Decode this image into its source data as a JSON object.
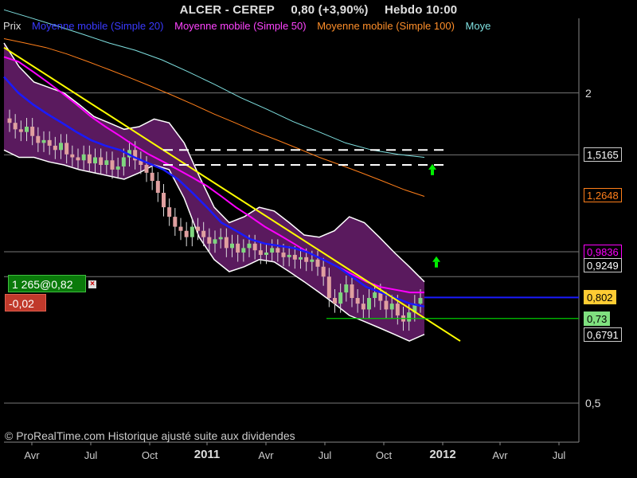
{
  "header": {
    "instrument": "ALCER - CEREP",
    "price_change": "0,80 (+3,90%)",
    "period_time": "Hebdo  10:00"
  },
  "legend": {
    "prix": "Prix",
    "ma20": "Moyenne mobile (Simple 20)",
    "ma50": "Moyenne mobile (Simple 50)",
    "ma100": "Moyenne mobile (Simple 100)",
    "ma_extra": "Moye"
  },
  "order": {
    "label": "1 265@0,82",
    "pnl": "-0,02"
  },
  "copyright": "© ProRealTime.com Historique ajusté suite aux dividendes",
  "colors": {
    "background": "#000000",
    "bollinger_fill": "#5a1a5e",
    "ma20": "#1a1aff",
    "ma50": "#ff00ff",
    "ma100": "#ff7f1a",
    "ma200": "#7fe0e0",
    "trendline": "#ffff00",
    "support_line": "#00cc00",
    "up_candle": "#7fd67f",
    "down_candle": "#e0a0a0"
  },
  "chart_data": {
    "type": "line",
    "y_scale": "log",
    "ylim": [
      0.42,
      2.6
    ],
    "y_ticks": [
      {
        "label": "2",
        "value": 2.0
      },
      {
        "label": "0,5",
        "value": 0.5
      }
    ],
    "x_ticks": [
      "Avr",
      "Jul",
      "Oct",
      "2011",
      "Avr",
      "Jul",
      "Oct",
      "2012",
      "Avr",
      "Jul"
    ],
    "price_labels": [
      {
        "label": "1,5165",
        "value": 1.5165,
        "color": "#ffffff",
        "bg": "#000000",
        "border": "#cccccc"
      },
      {
        "label": "1,2648",
        "value": 1.2648,
        "color": "#ff7f1a",
        "bg": "#000000",
        "border": "#ff7f1a"
      },
      {
        "label": "0,9836",
        "value": 0.9836,
        "color": "#ff00ff",
        "bg": "#000000",
        "border": "#ff00ff"
      },
      {
        "label": "0,9249",
        "value": 0.9249,
        "color": "#ffffff",
        "bg": "#000000",
        "border": "#cccccc"
      },
      {
        "label": "0,802",
        "value": 0.802,
        "color": "#000000",
        "bg": "#ffcc33",
        "border": "#ffcc33"
      },
      {
        "label": "0,73",
        "value": 0.73,
        "color": "#000000",
        "bg": "#7fe07f",
        "border": "#7fe07f"
      },
      {
        "label": "0,6791",
        "value": 0.6791,
        "color": "#ffffff",
        "bg": "#000000",
        "border": "#cccccc"
      }
    ],
    "ma20": [
      2.15,
      2.0,
      1.9,
      1.82,
      1.75,
      1.68,
      1.62,
      1.58,
      1.55,
      1.5,
      1.46,
      1.42,
      1.36,
      1.28,
      1.2,
      1.12,
      1.08,
      1.04,
      1.02,
      1.01,
      1.0,
      0.98,
      0.95,
      0.92,
      0.88,
      0.84,
      0.82,
      0.8,
      0.78,
      0.77
    ],
    "ma50": [
      2.35,
      2.3,
      2.2,
      2.1,
      2.0,
      1.9,
      1.8,
      1.72,
      1.65,
      1.58,
      1.52,
      1.47,
      1.42,
      1.37,
      1.32,
      1.26,
      1.2,
      1.15,
      1.1,
      1.06,
      1.02,
      0.98,
      0.95,
      0.92,
      0.89,
      0.86,
      0.84,
      0.83,
      0.82,
      0.82
    ],
    "ma100": [
      2.55,
      2.5,
      2.45,
      2.38,
      2.3,
      2.22,
      2.14,
      2.06,
      1.98,
      1.9,
      1.82,
      1.75,
      1.68,
      1.62,
      1.56,
      1.5,
      1.45,
      1.4,
      1.35,
      1.3,
      1.26
    ],
    "ma200": [
      2.9,
      2.8,
      2.7,
      2.6,
      2.5,
      2.42,
      2.32,
      2.2,
      2.08,
      1.96,
      1.86,
      1.76,
      1.68,
      1.6,
      1.55,
      1.52,
      1.5
    ],
    "bollinger_upper": [
      2.5,
      2.25,
      2.1,
      2.05,
      2.0,
      1.9,
      1.8,
      1.75,
      1.7,
      1.72,
      1.78,
      1.75,
      1.6,
      1.38,
      1.2,
      1.12,
      1.15,
      1.2,
      1.18,
      1.12,
      1.06,
      1.05,
      1.08,
      1.15,
      1.12,
      1.05,
      0.98,
      0.92,
      0.86
    ],
    "bollinger_lower": [
      1.55,
      1.5,
      1.5,
      1.47,
      1.45,
      1.42,
      1.4,
      1.38,
      1.36,
      1.4,
      1.45,
      1.42,
      1.25,
      1.05,
      0.95,
      0.9,
      0.92,
      0.95,
      0.94,
      0.9,
      0.86,
      0.82,
      0.78,
      0.74,
      0.72,
      0.7,
      0.68,
      0.66,
      0.68
    ],
    "trendline": {
      "from": 2.45,
      "to": 0.66
    },
    "resistance_lines": [
      1.55,
      1.45
    ],
    "support_line": 0.73,
    "horizontal_levels": [
      2.0,
      1.5165,
      0.9836,
      0.88,
      0.5
    ],
    "closes": [
      1.75,
      1.7,
      1.68,
      1.72,
      1.65,
      1.6,
      1.62,
      1.58,
      1.55,
      1.6,
      1.52,
      1.5,
      1.48,
      1.52,
      1.46,
      1.5,
      1.45,
      1.48,
      1.42,
      1.44,
      1.5,
      1.55,
      1.48,
      1.45,
      1.4,
      1.35,
      1.28,
      1.2,
      1.15,
      1.1,
      1.08,
      1.05,
      1.1,
      1.08,
      1.05,
      1.02,
      1.04,
      1.05,
      1.0,
      1.02,
      0.98,
      1.0,
      1.02,
      0.99,
      0.97,
      0.98,
      1.0,
      0.98,
      0.96,
      0.97,
      0.95,
      0.96,
      0.94,
      0.95,
      0.92,
      0.88,
      0.8,
      0.78,
      0.82,
      0.85,
      0.8,
      0.78,
      0.76,
      0.8,
      0.82,
      0.79,
      0.76,
      0.78,
      0.74,
      0.72,
      0.75,
      0.78,
      0.8
    ]
  }
}
